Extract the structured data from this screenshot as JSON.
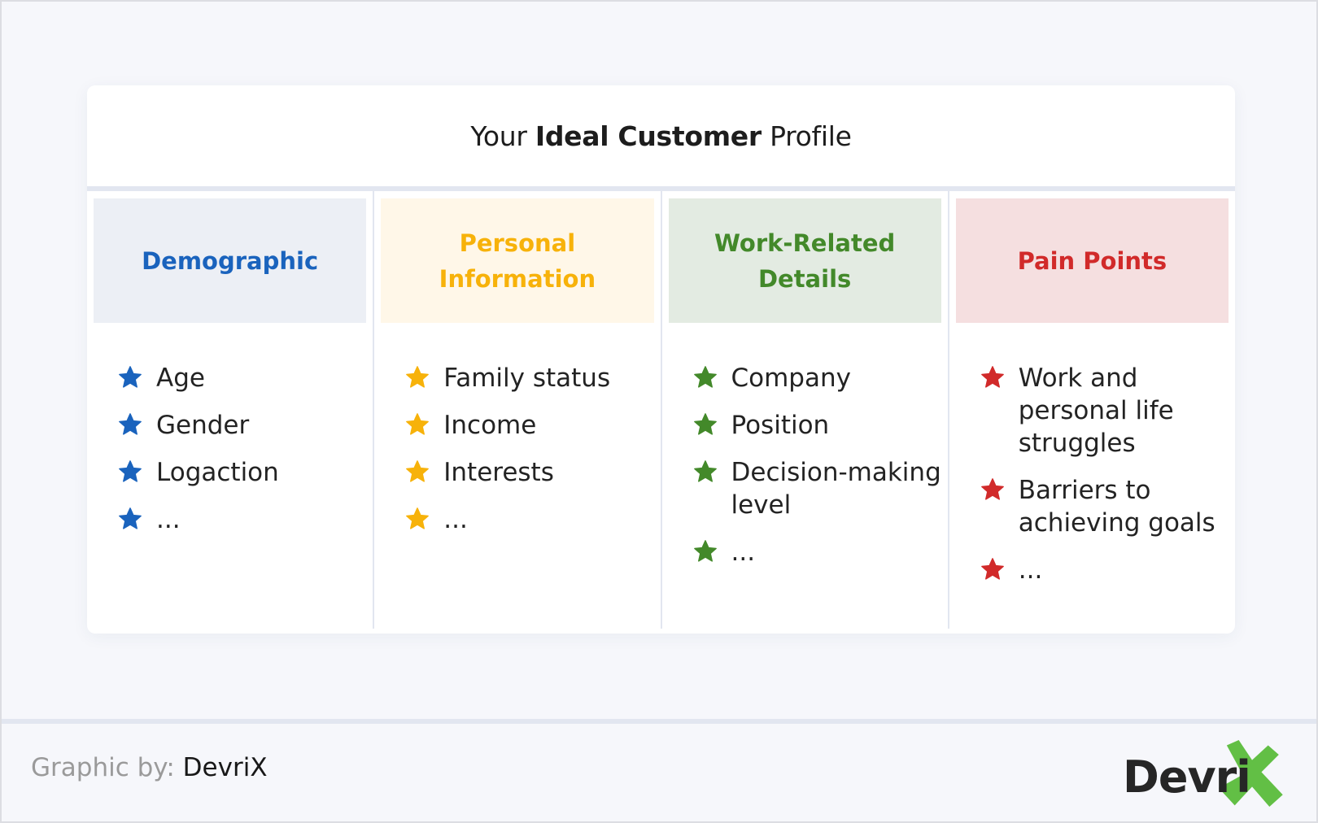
{
  "title": {
    "prefix": "Your",
    "bold": "Ideal Customer",
    "suffix": "Profile"
  },
  "columns": [
    {
      "heading": "Demographic",
      "color": "#1a63bd",
      "bg": "#eceff5",
      "icon": "star-icon",
      "items": [
        "Age",
        "Gender",
        "Logaction",
        "..."
      ]
    },
    {
      "heading": "Personal Information",
      "color": "#f7b20a",
      "bg": "#fff7e8",
      "icon": "star-icon",
      "items": [
        "Family status",
        "Income",
        "Interests",
        "..."
      ]
    },
    {
      "heading": "Work-Related Details",
      "color": "#43892a",
      "bg": "#e3ebe2",
      "icon": "star-icon",
      "items": [
        "Company",
        "Position",
        "Decision-making level",
        "..."
      ]
    },
    {
      "heading": "Pain Points",
      "color": "#d12a2a",
      "bg": "#f5dfe0",
      "icon": "star-icon",
      "items": [
        "Work and personal life struggles",
        "Barriers to achieving goals",
        "..."
      ]
    }
  ],
  "footer": {
    "credit_label": "Graphic by:",
    "credit_name": "DevriX",
    "logo_text": "Devri",
    "logo_mark_color": "#62bf45"
  }
}
